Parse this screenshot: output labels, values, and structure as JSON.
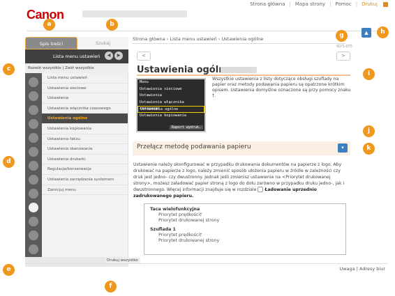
{
  "header": {
    "logo": "Canon",
    "links": [
      "Strona główna",
      "Mapa strony",
      "Pomoc",
      "Drukuj"
    ]
  },
  "left_panel": {
    "tab_contents": "Spis treści",
    "tab_search": "Szukaj",
    "menu_title": "Lista menu ustawień",
    "expand_all": "Rozwiń wszystkie",
    "collapse_all": "Zwiń wszystkie",
    "menu_items": [
      "Lista menu ustawień",
      "Ustawienia sieciowe",
      "Ustawienia",
      "Ustawienia włącznika czasowego",
      "Ustawienia ogólne",
      "Ustawienia kopiowania",
      "Ustawienia faksu",
      "Ustawienia skanowania",
      "Ustawienia drukarki",
      "Regulacja/konserwacja",
      "Ustawienia zarządzania systemem",
      "Zainicjuj menu"
    ],
    "print_all": "Drukuj wszystko"
  },
  "main": {
    "breadcrumb": "Strona główna › Lista menu ustawień › Ustawienia ogólne",
    "page_id": "0LYS-075",
    "heading": "Ustawienia ogólne",
    "intro": "Wszystkie ustawienia z listy dotyczące obsługi szuflady na papier oraz metody podawania papieru są opatrzone krótkim opisem. Ustawienia domyślne oznaczone są przy pomocy znaku †.",
    "lcd": {
      "rows": [
        "Menu",
        "Ustawienia sieciowe",
        "Ustawienia",
        "Ustawienia włącznika czasowego",
        "Ustawienia ogólne",
        "Ustawienia kopiowania"
      ],
      "button": "Raport wydruk."
    },
    "section_title": "Przełącz metodę podawania papieru",
    "body_text": "Ustawienie należy skonfigurować w przypadku drukowania dokumentów na papierze z logo. Aby drukować na papierze z logo, należy zmienić sposób ułożenia papieru w źródle w zależności czy druk jest jedno- czy dwustronny. Jednak jeśli zmienisz ustawienie na <Priorytet drukowanej strony>, możesz załadować papier stroną z logo do dołu zarówno w przypadku druku jedno-, jak i dwustronnego. Więcej informacji znajduje się w rozdziale",
    "body_link": "Ładowanie uprzednio zadrukowanego papieru.",
    "table": {
      "group1": "Taca wielofunkcyjna",
      "group1_items": [
        "Priorytet prędkości†",
        "Priorytet drukowanej strony"
      ],
      "group2": "Szuflada 1",
      "group2_items": [
        "Priorytet prędkości†",
        "Priorytet drukowanej strony"
      ]
    }
  },
  "footer": {
    "links": [
      "Uwaga",
      "Adresy biur"
    ]
  },
  "callouts": [
    "a",
    "b",
    "c",
    "d",
    "e",
    "f",
    "g",
    "h",
    "i",
    "j",
    "k"
  ],
  "colors": {
    "brand_red": "#cc0000",
    "callout_orange": "#f0971e",
    "accent_blue": "#3d7ec0"
  }
}
